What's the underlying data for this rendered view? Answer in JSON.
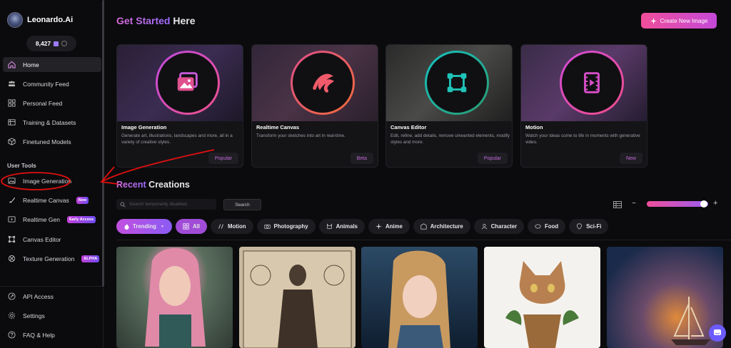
{
  "brand": {
    "name": "Leonardo.Ai"
  },
  "tokens": {
    "count": "8,427"
  },
  "nav": {
    "home": "Home",
    "community": "Community Feed",
    "personal": "Personal Feed",
    "training": "Training & Datasets",
    "finetuned": "Finetuned Models",
    "user_tools_heading": "User Tools",
    "image_generation": "Image Generation",
    "realtime_canvas": "Realtime Canvas",
    "realtime_canvas_badge": "New",
    "realtime_gen": "Realtime Gen",
    "realtime_gen_badge": "Early Access",
    "canvas_editor": "Canvas Editor",
    "texture_generation": "Texture Generation",
    "texture_badge": "ALPHA",
    "api_access": "API Access",
    "settings": "Settings",
    "faq": "FAQ & Help"
  },
  "header": {
    "title_accent": "Get Started",
    "title_rest": " Here",
    "create_button": "Create New Image"
  },
  "cards": [
    {
      "title": "Image Generation",
      "desc": "Generate art, illustrations, landscapes and more, all in a variety of creative styles.",
      "tag": "Popular"
    },
    {
      "title": "Realtime Canvas",
      "desc": "Transform your sketches into art in real-time.",
      "tag": "Beta"
    },
    {
      "title": "Canvas Editor",
      "desc": "Edit, refine, add details, remove unwanted elements, modify styles and more.",
      "tag": "Popular"
    },
    {
      "title": "Motion",
      "desc": "Watch your ideas come to life in moments with generative video.",
      "tag": "New"
    }
  ],
  "recent": {
    "title_accent": "Recent",
    "title_rest": " Creations",
    "search_placeholder": "Search temporarily disabled.",
    "search_button": "Search"
  },
  "filters": {
    "trending": "Trending",
    "chips": [
      "All",
      "Motion",
      "Photography",
      "Animals",
      "Anime",
      "Architecture",
      "Character",
      "Food",
      "Sci-Fi"
    ]
  },
  "colors": {
    "accent": "#c449d8",
    "annotation": "#e01010"
  }
}
